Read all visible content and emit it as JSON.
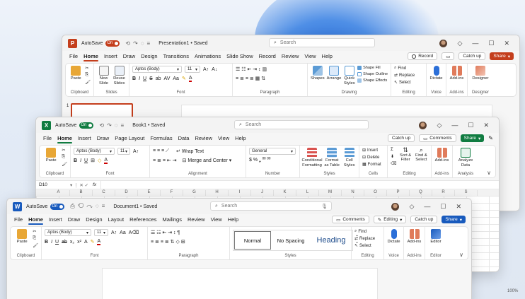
{
  "colors": {
    "ppt": "#c43e1c",
    "excel": "#107c41",
    "word": "#185abd"
  },
  "ppt": {
    "title": "Presentation1 • Saved",
    "autosave": "AutoSave",
    "toggle": "On",
    "search": "Search",
    "tabs": [
      "File",
      "Home",
      "Insert",
      "Draw",
      "Design",
      "Transitions",
      "Animations",
      "Slide Show",
      "Record",
      "Review",
      "View",
      "Help"
    ],
    "record": "Record",
    "catchup": "Catch up",
    "share": "Share",
    "clipboard": {
      "paste": "Paste",
      "label": "Clipboard"
    },
    "slides": {
      "new_slide": "New Slide",
      "reuse": "Reuse Slides",
      "label": "Slides"
    },
    "font": {
      "name": "Aptos (Body)",
      "size": "11",
      "label": "Font"
    },
    "paragraph": {
      "label": "Paragraph"
    },
    "drawing": {
      "shapes": "Shapes",
      "arrange": "Arrange",
      "quick": "Quick Styles",
      "fill": "Shape Fill",
      "outline": "Shape Outline",
      "effects": "Shape Effects",
      "label": "Drawing"
    },
    "editing": {
      "find": "Find",
      "replace": "Replace",
      "select": "Select",
      "label": "Editing"
    },
    "voice": {
      "dictate": "Dictate",
      "label": "Voice"
    },
    "addins": {
      "btn": "Add-ins",
      "label": "Add-ins"
    },
    "designer": {
      "btn": "Designer",
      "label": "Designer"
    },
    "slide_num": "1"
  },
  "excel": {
    "title": "Book1 • Saved",
    "autosave": "AutoSave",
    "toggle": "On",
    "search": "Search",
    "tabs": [
      "File",
      "Home",
      "Insert",
      "Draw",
      "Page Layout",
      "Formulas",
      "Data",
      "Review",
      "View",
      "Help"
    ],
    "catchup": "Catch up",
    "comments": "Comments",
    "share": "Share",
    "clipboard": {
      "paste": "Paste",
      "label": "Clipboard"
    },
    "font": {
      "name": "Aptos (Body)",
      "size": "11",
      "label": "Font"
    },
    "alignment": {
      "wrap": "Wrap Text",
      "merge": "Merge and Center",
      "label": "Alignment"
    },
    "number": {
      "format": "General",
      "label": "Number"
    },
    "styles": {
      "cond": "Conditional Formatting",
      "table": "Format as Table",
      "cell": "Cell Styles",
      "label": "Styles"
    },
    "cells": {
      "insert": "Insert",
      "delete": "Delete",
      "format": "Format",
      "label": "Cells"
    },
    "editing": {
      "sort": "Sort & Filter",
      "find": "Find & Select",
      "label": "Editing"
    },
    "addins": {
      "btn": "Add-ins",
      "label": "Add-ins"
    },
    "analysis": {
      "btn": "Analyze Data",
      "label": "Analysis"
    },
    "cellref": "D10",
    "fx": "fx",
    "columns": [
      "A",
      "B",
      "C",
      "D",
      "E",
      "F",
      "G",
      "H",
      "I",
      "J",
      "K",
      "L",
      "M",
      "N",
      "O",
      "P",
      "Q",
      "R",
      "S"
    ],
    "status_pct": "100%"
  },
  "word": {
    "title": "Document1 • Saved",
    "autosave": "AutoSave",
    "toggle": "On",
    "search": "Search",
    "tabs": [
      "File",
      "Home",
      "Insert",
      "Draw",
      "Design",
      "Layout",
      "References",
      "Mailings",
      "Review",
      "View",
      "Help"
    ],
    "comments": "Comments",
    "editing_mode": "Editing",
    "catchup": "Catch up",
    "share": "Share",
    "clipboard": {
      "paste": "Paste",
      "label": "Clipboard"
    },
    "font": {
      "name": "Aptos (Body)",
      "size": "11",
      "label": "Font"
    },
    "paragraph": {
      "label": "Paragraph"
    },
    "styles": {
      "normal": "Normal",
      "nospacing": "No Spacing",
      "heading": "Heading",
      "label": "Styles"
    },
    "editing": {
      "find": "Find",
      "replace": "Replace",
      "select": "Select",
      "label": "Editing"
    },
    "voice": {
      "dictate": "Dictate",
      "label": "Voice"
    },
    "addins": {
      "btn": "Add-ins",
      "label": "Add-ins"
    },
    "editor": {
      "btn": "Editor",
      "label": "Editor"
    }
  }
}
